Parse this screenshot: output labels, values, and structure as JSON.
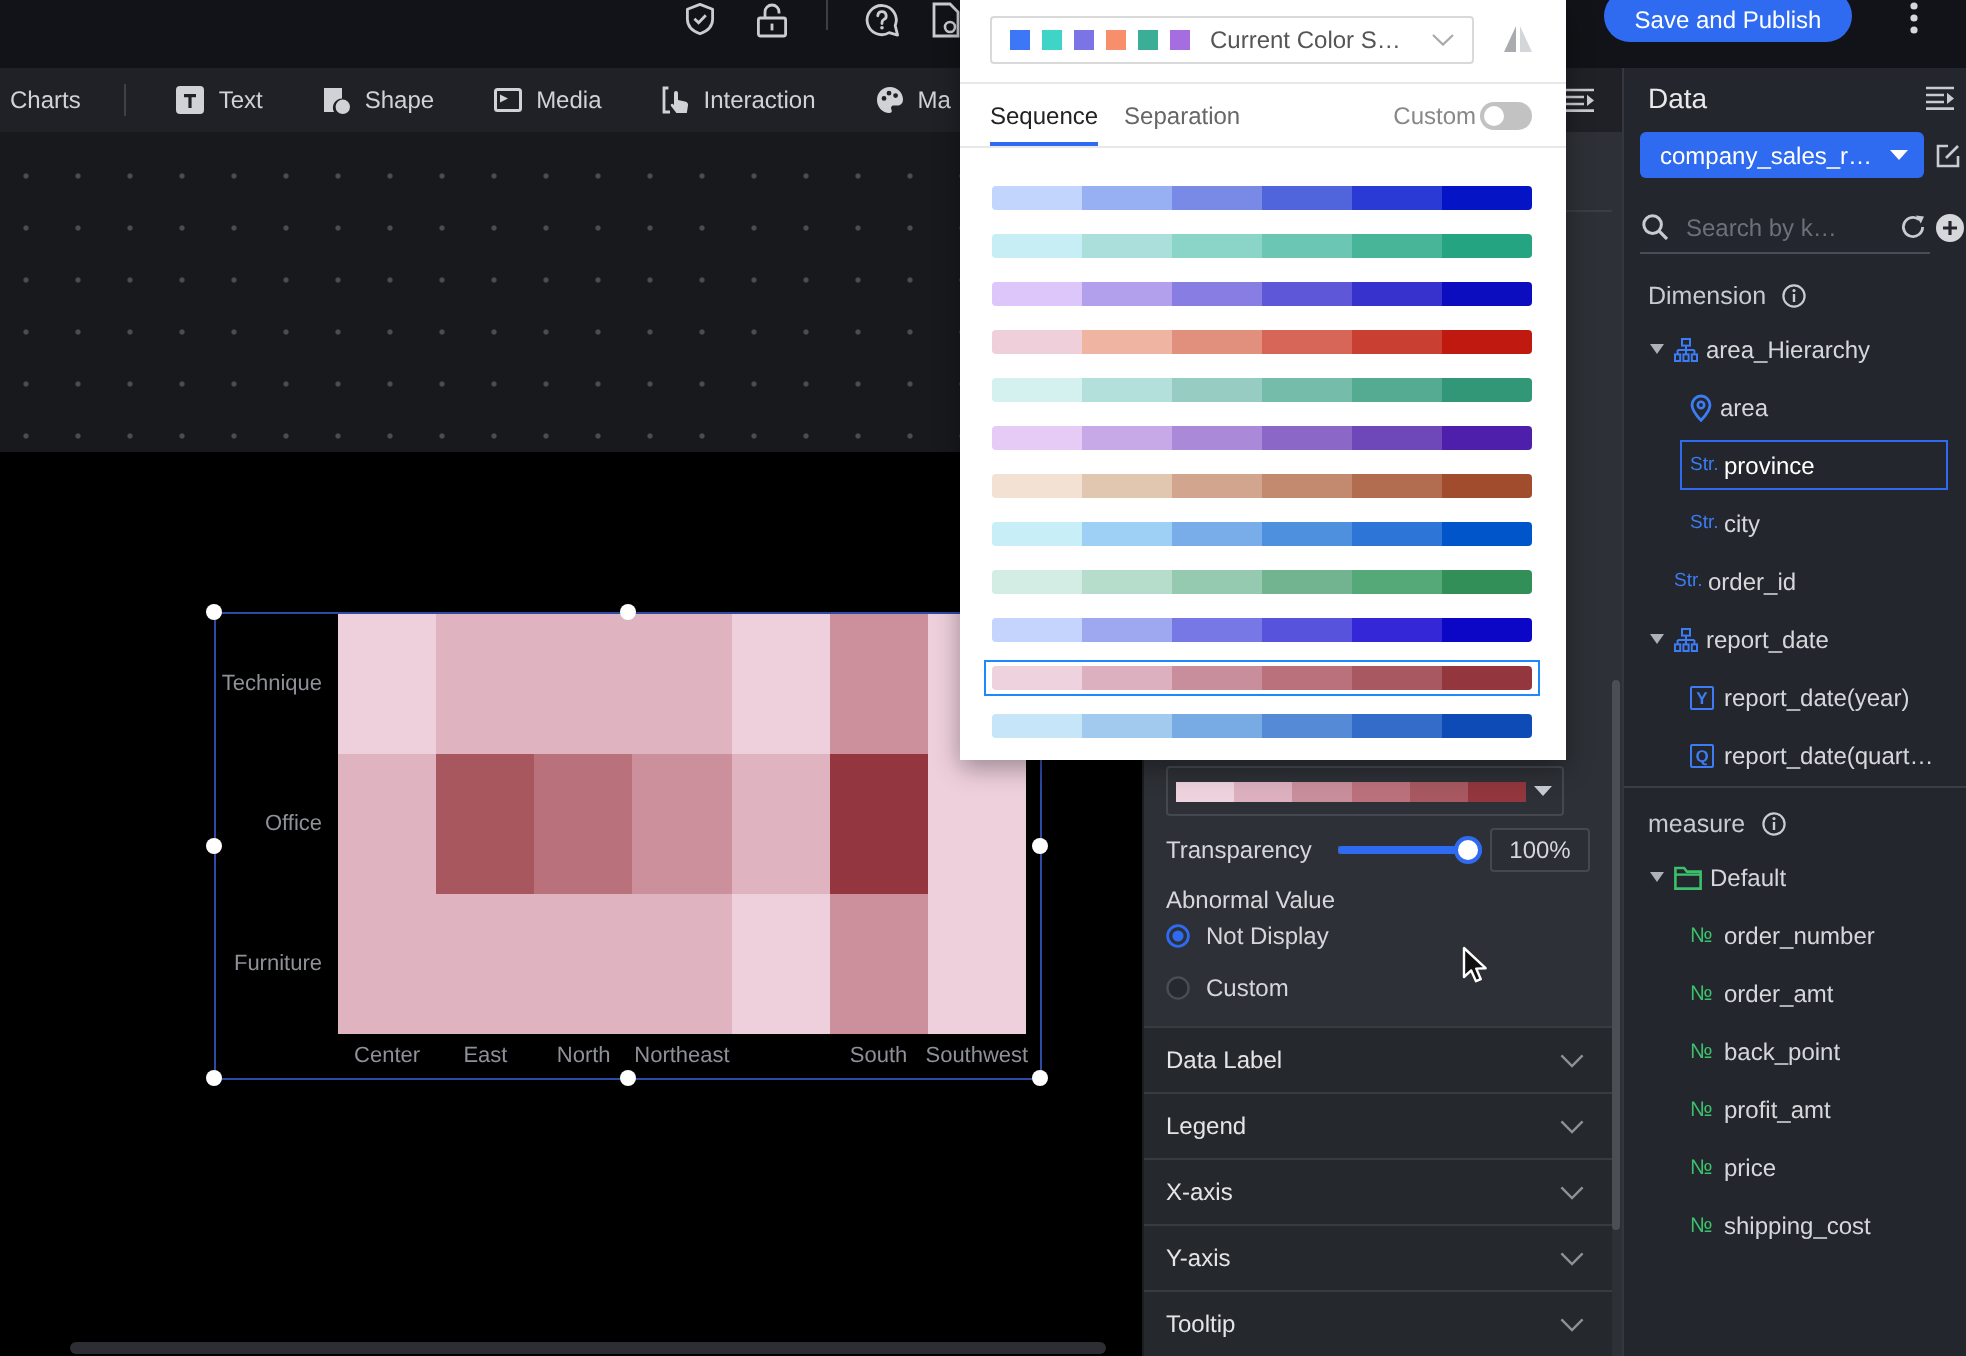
{
  "top_bar": {
    "publish_button": "Save and Publish"
  },
  "toolbar": {
    "charts_label": "Charts",
    "items": [
      "Text",
      "Shape",
      "Media",
      "Interaction",
      "Ma"
    ]
  },
  "color_popup": {
    "scheme_select": {
      "value": "Current Color S…",
      "swatches": [
        {
          "color": "#3d76f6"
        },
        {
          "color": "#3fd4c8"
        },
        {
          "color": "#7a74e6"
        },
        {
          "color": "#f78f6d"
        },
        {
          "color": "#3aae97"
        },
        {
          "color": "#a66de0"
        }
      ]
    },
    "tabs": [
      {
        "label": "Sequence",
        "selected": true
      },
      {
        "label": "Separation",
        "selected": false
      }
    ],
    "custom_toggle": {
      "label": "Custom",
      "on": false
    },
    "palettes": [
      {
        "selected": false,
        "swatches": [
          {
            "color": "#c2d5fd"
          },
          {
            "color": "#97b0f4"
          },
          {
            "color": "#7889e6"
          },
          {
            "color": "#5065dc"
          },
          {
            "color": "#2a3ad4"
          },
          {
            "color": "#0515c5"
          }
        ]
      },
      {
        "selected": false,
        "swatches": [
          {
            "color": "#c8eef5"
          },
          {
            "color": "#aadfdb"
          },
          {
            "color": "#8bd4c8"
          },
          {
            "color": "#6bc7b3"
          },
          {
            "color": "#48b598"
          },
          {
            "color": "#25a482"
          }
        ]
      },
      {
        "selected": false,
        "swatches": [
          {
            "color": "#dcc6fa"
          },
          {
            "color": "#b3a0ed"
          },
          {
            "color": "#887de3"
          },
          {
            "color": "#5e58d8"
          },
          {
            "color": "#3732ce"
          },
          {
            "color": "#0d0dc0"
          }
        ]
      },
      {
        "selected": false,
        "swatches": [
          {
            "color": "#efd0da"
          },
          {
            "color": "#efb4a2"
          },
          {
            "color": "#e2907e"
          },
          {
            "color": "#d86658"
          },
          {
            "color": "#c93f32"
          },
          {
            "color": "#c0190f"
          }
        ]
      },
      {
        "selected": false,
        "swatches": [
          {
            "color": "#d4f0ef"
          },
          {
            "color": "#b4e0dc"
          },
          {
            "color": "#97ccc2"
          },
          {
            "color": "#75bdaa"
          },
          {
            "color": "#55ab91"
          },
          {
            "color": "#319777"
          }
        ]
      },
      {
        "selected": false,
        "swatches": [
          {
            "color": "#e6cbf6"
          },
          {
            "color": "#c6a9e6"
          },
          {
            "color": "#aa89d8"
          },
          {
            "color": "#8b67c8"
          },
          {
            "color": "#6e48b9"
          },
          {
            "color": "#4e1fab"
          }
        ]
      },
      {
        "selected": false,
        "swatches": [
          {
            "color": "#f3e2d3"
          },
          {
            "color": "#e2c7b0"
          },
          {
            "color": "#d2a58e"
          },
          {
            "color": "#c38a6f"
          },
          {
            "color": "#b26c50"
          },
          {
            "color": "#a04c2d"
          }
        ]
      },
      {
        "selected": false,
        "swatches": [
          {
            "color": "#c8eff8"
          },
          {
            "color": "#9dd0f4"
          },
          {
            "color": "#79adea"
          },
          {
            "color": "#4f90de"
          },
          {
            "color": "#2d75d7"
          },
          {
            "color": "#0055cb"
          }
        ]
      },
      {
        "selected": false,
        "swatches": [
          {
            "color": "#d3ece4"
          },
          {
            "color": "#b6dccb"
          },
          {
            "color": "#95cab0"
          },
          {
            "color": "#72b490"
          },
          {
            "color": "#55a877"
          },
          {
            "color": "#338f58"
          }
        ]
      },
      {
        "selected": false,
        "swatches": [
          {
            "color": "#c4d4fd"
          },
          {
            "color": "#9ea8f1"
          },
          {
            "color": "#7777e6"
          },
          {
            "color": "#5853dd"
          },
          {
            "color": "#3427d7"
          },
          {
            "color": "#0c06c7"
          }
        ]
      },
      {
        "selected": true,
        "swatches": [
          {
            "color": "#eed2de"
          },
          {
            "color": "#dcb0bf"
          },
          {
            "color": "#c98e9b"
          },
          {
            "color": "#bb717b"
          },
          {
            "color": "#a75860"
          },
          {
            "color": "#93363d"
          }
        ]
      },
      {
        "selected": false,
        "swatches": [
          {
            "color": "#c6e5f8"
          },
          {
            "color": "#a2c9ee"
          },
          {
            "color": "#78abe3"
          },
          {
            "color": "#558ad6"
          },
          {
            "color": "#336dc9"
          },
          {
            "color": "#0f4bb7"
          }
        ]
      }
    ]
  },
  "canvas": {
    "heatmap": {
      "row_labels": [
        "Technique",
        "Office",
        "Furniture"
      ],
      "columns": [
        {
          "label": "Center",
          "cells": [
            {
              "color": "#eed0dc"
            },
            {
              "color": "#dfb3c0"
            },
            {
              "color": "#dfb3c0"
            }
          ]
        },
        {
          "label": "East",
          "cells": [
            {
              "color": "#dfb3c0"
            },
            {
              "color": "#a9575f"
            },
            {
              "color": "#dfb3c0"
            }
          ]
        },
        {
          "label": "North",
          "cells": [
            {
              "color": "#dfb3c0"
            },
            {
              "color": "#b9717b"
            },
            {
              "color": "#dfb3c0"
            }
          ]
        },
        {
          "label": "Northeast",
          "cells": [
            {
              "color": "#dfb3c0"
            },
            {
              "color": "#cc909d"
            },
            {
              "color": "#dfb3c0"
            }
          ]
        },
        {
          "cells": [
            {
              "color": "#eed0dc"
            },
            {
              "color": "#dfb3c0"
            },
            {
              "color": "#eed0dc"
            }
          ]
        },
        {
          "label": "South",
          "cells": [
            {
              "color": "#cc909d"
            },
            {
              "color": "#94363f"
            },
            {
              "color": "#cc909d"
            }
          ]
        },
        {
          "label": "Southwest",
          "cells": [
            {
              "color": "#eed0dc"
            },
            {
              "color": "#eed0dc"
            },
            {
              "color": "#eed0dc"
            }
          ]
        }
      ]
    }
  },
  "settings_panel": {
    "palette_select": {
      "swatches": [
        {
          "color": "#eed2de"
        },
        {
          "color": "#dcb0bf"
        },
        {
          "color": "#c98e9b"
        },
        {
          "color": "#bb717b"
        },
        {
          "color": "#a75860"
        },
        {
          "color": "#93363d"
        }
      ]
    },
    "transparency": {
      "label": "Transparency",
      "level": 1,
      "value": "100%"
    },
    "abnormal_value": {
      "label": "Abnormal Value",
      "options": [
        {
          "label": "Not Display",
          "selected": true
        },
        {
          "label": "Custom",
          "selected": false
        }
      ]
    },
    "sections": [
      {
        "label": "Data Label",
        "expanded": false
      },
      {
        "label": "Legend",
        "expanded": false
      },
      {
        "label": "X-axis",
        "expanded": false
      },
      {
        "label": "Y-axis",
        "expanded": false
      },
      {
        "label": "Tooltip",
        "expanded": false
      }
    ]
  },
  "data_panel": {
    "title": "Data",
    "dataset": "company_sales_r…",
    "search": {
      "placeholder": "Search by k…"
    },
    "groups": [
      {
        "label": "Dimension",
        "items": [
          {
            "label": "area_Hierarchy",
            "kind": "hierarchy",
            "expanded": true,
            "selected": false,
            "children": [
              {
                "label": "area",
                "kind": "geo",
                "selected": false
              },
              {
                "label": "province",
                "kind": "string",
                "type_label": "Str.",
                "selected": true
              },
              {
                "label": "city",
                "kind": "string",
                "type_label": "Str.",
                "selected": false
              }
            ]
          },
          {
            "label": "order_id",
            "kind": "string",
            "type_label": "Str.",
            "selected": false
          },
          {
            "label": "report_date",
            "kind": "hierarchy",
            "expanded": true,
            "selected": false,
            "children": [
              {
                "label": "report_date(year)",
                "kind": "date",
                "type_label": "Y",
                "selected": false
              },
              {
                "label": "report_date(quart…",
                "kind": "date",
                "type_label": "Q",
                "selected": false
              }
            ]
          }
        ]
      },
      {
        "label": "measure",
        "items": [
          {
            "label": "Default",
            "kind": "folder",
            "expanded": true,
            "selected": false,
            "children": [
              {
                "label": "order_number",
                "kind": "number",
                "type_label": "№",
                "selected": false
              },
              {
                "label": "order_amt",
                "kind": "number",
                "type_label": "№",
                "selected": false
              },
              {
                "label": "back_point",
                "kind": "number",
                "type_label": "№",
                "selected": false
              },
              {
                "label": "profit_amt",
                "kind": "number",
                "type_label": "№",
                "selected": false
              },
              {
                "label": "price",
                "kind": "number",
                "type_label": "№",
                "selected": false
              },
              {
                "label": "shipping_cost",
                "kind": "number",
                "type_label": "№",
                "selected": false
              }
            ]
          }
        ]
      }
    ]
  }
}
